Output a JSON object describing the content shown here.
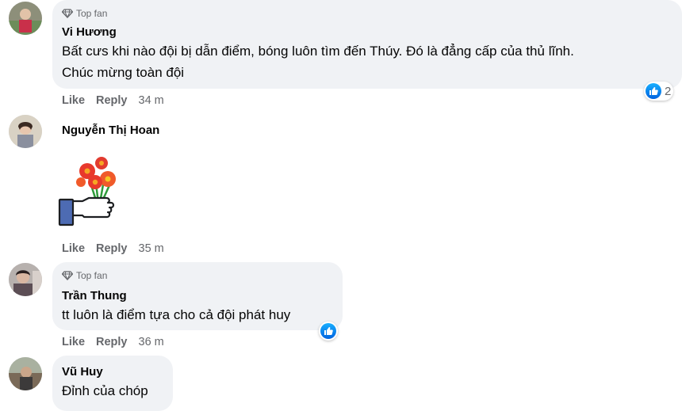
{
  "colors": {
    "bubble_bg": "#f0f2f5",
    "meta_text": "#65676b",
    "like_blue": "#0866ff"
  },
  "actions": {
    "like": "Like",
    "reply": "Reply"
  },
  "comments": [
    {
      "badge": "Top fan",
      "author": "Vi Hương",
      "lines": [
        "Bất cưs khi nào đội bị dẫn điểm, bóng luôn tìm đến Thúy. Đó là đẳng cấp của thủ lĩnh.",
        "Chúc mừng toàn đội"
      ],
      "time": "34 m",
      "reaction_count": "2"
    },
    {
      "author": "Nguyễn Thị Hoan",
      "sticker": "flower-bouquet-hand-sticker",
      "time": "35 m"
    },
    {
      "badge": "Top fan",
      "author": "Trần Thung",
      "lines": [
        "tt luôn là điểm tựa cho cả đội phát huy"
      ],
      "time": "36 m"
    },
    {
      "author": "Vũ Huy",
      "lines": [
        "Đỉnh của chóp"
      ]
    }
  ]
}
